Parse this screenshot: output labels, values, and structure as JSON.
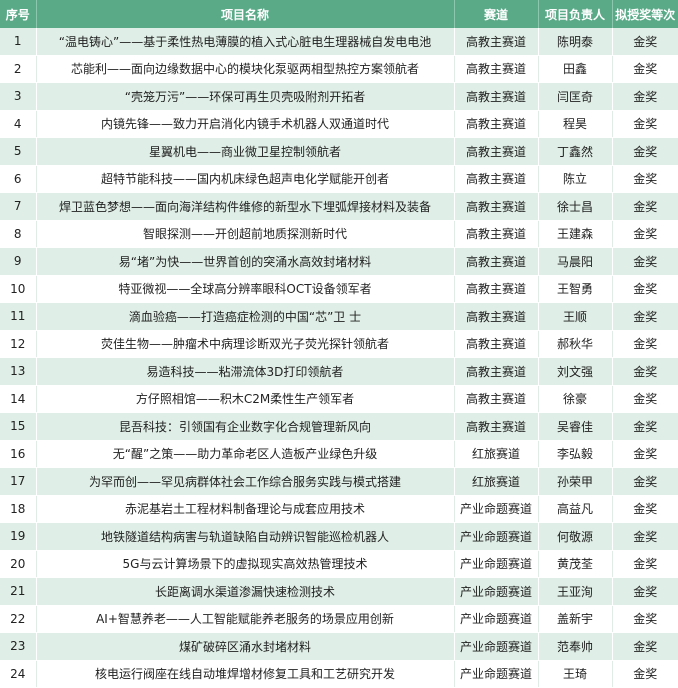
{
  "header": {
    "no": "序号",
    "name": "项目名称",
    "track": "赛道",
    "leader": "项目负责人",
    "award": "拟授奖等次"
  },
  "rows": [
    {
      "no": "1",
      "name": "“温电铸心”——基于柔性热电薄膜的植入式心脏电生理器械自发电电池",
      "track": "高教主赛道",
      "leader": "陈明泰",
      "award": "金奖"
    },
    {
      "no": "2",
      "name": "芯能利——面向边缘数据中心的模块化泵驱两相型热控方案领航者",
      "track": "高教主赛道",
      "leader": "田鑫",
      "award": "金奖"
    },
    {
      "no": "3",
      "name": "“壳笼万污”——环保可再生贝壳吸附剂开拓者",
      "track": "高教主赛道",
      "leader": "闫匡奇",
      "award": "金奖"
    },
    {
      "no": "4",
      "name": "内镜先锋——致力开启消化内镜手术机器人双通道时代",
      "track": "高教主赛道",
      "leader": "程昊",
      "award": "金奖"
    },
    {
      "no": "5",
      "name": "星翼机电——商业微卫星控制领航者",
      "track": "高教主赛道",
      "leader": "丁鑫然",
      "award": "金奖"
    },
    {
      "no": "6",
      "name": "超特节能科技——国内机床绿色超声电化学赋能开创者",
      "track": "高教主赛道",
      "leader": "陈立",
      "award": "金奖"
    },
    {
      "no": "7",
      "name": "焊卫蓝色梦想——面向海洋结构件维修的新型水下埋弧焊接材料及装备",
      "track": "高教主赛道",
      "leader": "徐士昌",
      "award": "金奖"
    },
    {
      "no": "8",
      "name": "智眼探测——开创超前地质探测新时代",
      "track": "高教主赛道",
      "leader": "王建森",
      "award": "金奖"
    },
    {
      "no": "9",
      "name": "易“堵”为快——世界首创的突涌水高效封堵材料",
      "track": "高教主赛道",
      "leader": "马晨阳",
      "award": "金奖"
    },
    {
      "no": "10",
      "name": "特亚微视——全球高分辨率眼科OCT设备领军者",
      "track": "高教主赛道",
      "leader": "王智勇",
      "award": "金奖"
    },
    {
      "no": "11",
      "name": "滴血验癌——打造癌症检测的中国“芯”卫 士",
      "track": "高教主赛道",
      "leader": "王顺",
      "award": "金奖"
    },
    {
      "no": "12",
      "name": "荧佳生物——肿瘤术中病理诊断双光子荧光探针领航者",
      "track": "高教主赛道",
      "leader": "郝秋华",
      "award": "金奖"
    },
    {
      "no": "13",
      "name": "易造科技——粘滞流体3D打印领航者",
      "track": "高教主赛道",
      "leader": "刘文强",
      "award": "金奖"
    },
    {
      "no": "14",
      "name": "方仔照相馆——积木C2M柔性生产领军者",
      "track": "高教主赛道",
      "leader": "徐豪",
      "award": "金奖"
    },
    {
      "no": "15",
      "name": "昆吾科技：引领国有企业数字化合规管理新风向",
      "track": "高教主赛道",
      "leader": "吴睿佳",
      "award": "金奖"
    },
    {
      "no": "16",
      "name": "无“醒”之策——助力革命老区人造板产业绿色升级",
      "track": "红旅赛道",
      "leader": "李弘毅",
      "award": "金奖"
    },
    {
      "no": "17",
      "name": "为罕而创——罕见病群体社会工作综合服务实践与模式搭建",
      "track": "红旅赛道",
      "leader": "孙荣甲",
      "award": "金奖"
    },
    {
      "no": "18",
      "name": "赤泥基岩土工程材料制备理论与成套应用技术",
      "track": "产业命题赛道",
      "leader": "高益凡",
      "award": "金奖"
    },
    {
      "no": "19",
      "name": "地铁隧道结构病害与轨道缺陷自动辨识智能巡检机器人",
      "track": "产业命题赛道",
      "leader": "何敬源",
      "award": "金奖"
    },
    {
      "no": "20",
      "name": "5G与云计算场景下的虚拟现实高效热管理技术",
      "track": "产业命题赛道",
      "leader": "黄茂荃",
      "award": "金奖"
    },
    {
      "no": "21",
      "name": "长距离调水渠道渗漏快速检测技术",
      "track": "产业命题赛道",
      "leader": "王亚洵",
      "award": "金奖"
    },
    {
      "no": "22",
      "name": "AI+智慧养老——人工智能赋能养老服务的场景应用创新",
      "track": "产业命题赛道",
      "leader": "盖新宇",
      "award": "金奖"
    },
    {
      "no": "23",
      "name": "煤矿破碎区涌水封堵材料",
      "track": "产业命题赛道",
      "leader": "范奉帅",
      "award": "金奖"
    },
    {
      "no": "24",
      "name": "核电运行阀座在线自动堆焊增材修复工具和工艺研究开发",
      "track": "产业命题赛道",
      "leader": "王琦",
      "award": "金奖"
    }
  ]
}
